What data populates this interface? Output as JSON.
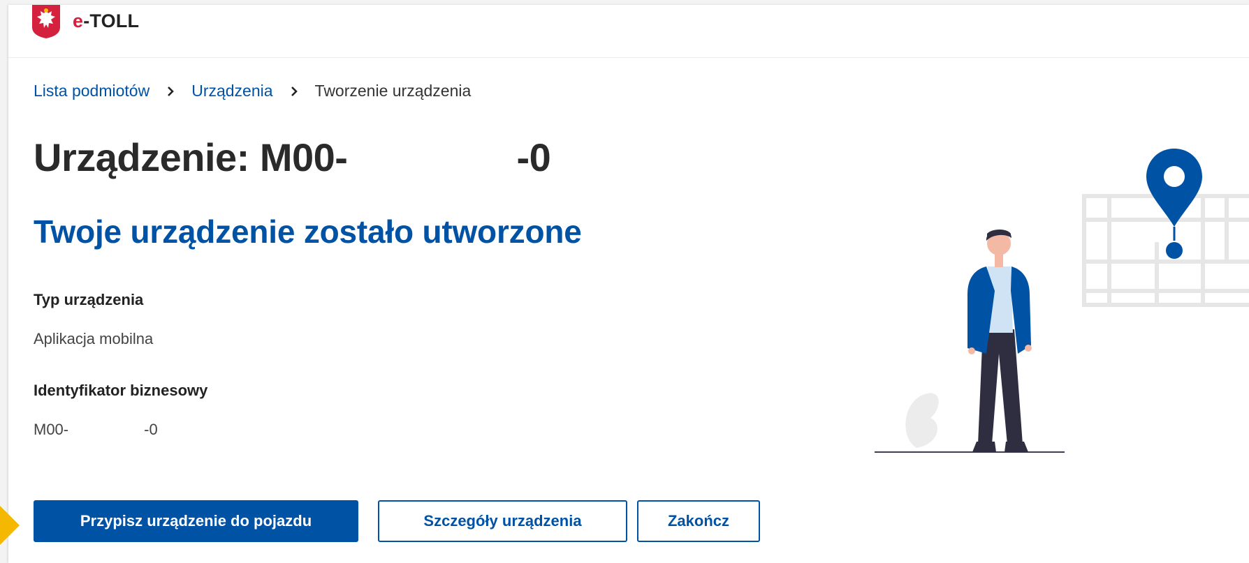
{
  "header": {
    "logo": {
      "prefix": "e",
      "suffix": "-TOLL",
      "emblem_icon": "polish-eagle-emblem"
    }
  },
  "breadcrumb": {
    "items": [
      {
        "label": "Lista podmiotów"
      },
      {
        "label": "Urządzenia"
      },
      {
        "label": "Tworzenie urządzenia"
      }
    ],
    "separator_icon": "chevron-right-icon"
  },
  "page": {
    "title_prefix": "Urządzenie: M00-",
    "title_suffix": "-0",
    "success_heading": "Twoje urządzenie zostało utworzone"
  },
  "fields": {
    "device_type": {
      "label": "Typ urządzenia",
      "value": "Aplikacja mobilna"
    },
    "business_id": {
      "label": "Identyfikator biznesowy",
      "value_prefix": "M00-",
      "value_suffix": "-0"
    }
  },
  "actions": {
    "assign": "Przypisz urządzenie do pojazdu",
    "details": "Szczegóły urządzenia",
    "finish": "Zakończ"
  },
  "colors": {
    "brand_blue": "#0052a5",
    "logo_red": "#d4213d",
    "pointer_yellow": "#f5b800"
  }
}
